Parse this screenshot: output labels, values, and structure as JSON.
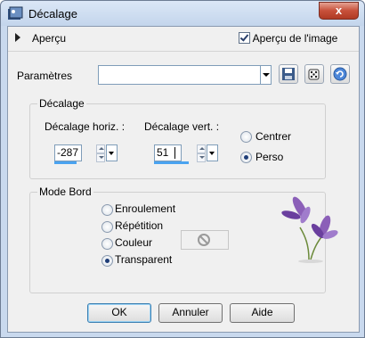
{
  "window": {
    "title": "Décalage",
    "close_label": "x"
  },
  "preview": {
    "label": "Aperçu",
    "image_preview_label": "Aperçu de l'image",
    "image_preview_checked": true
  },
  "presets": {
    "label": "Paramètres",
    "value": "",
    "icons": [
      "save-icon",
      "dice-icon",
      "reset-icon"
    ]
  },
  "offset": {
    "group_title": "Décalage",
    "horizontal_label": "Décalage horiz. :",
    "horizontal_value": "-287",
    "vertical_label": "Décalage vert. :",
    "vertical_value": "51",
    "mode_options": [
      "Centrer",
      "Perso"
    ],
    "mode_selected": "Perso"
  },
  "edge_mode": {
    "group_title": "Mode Bord",
    "options": [
      "Enroulement",
      "Répétition",
      "Couleur",
      "Transparent"
    ],
    "selected": "Transparent"
  },
  "buttons": {
    "ok": "OK",
    "cancel": "Annuler",
    "help": "Aide"
  },
  "colors": {
    "accent": "#4aa3f0",
    "flower": "#8b5fb8"
  }
}
